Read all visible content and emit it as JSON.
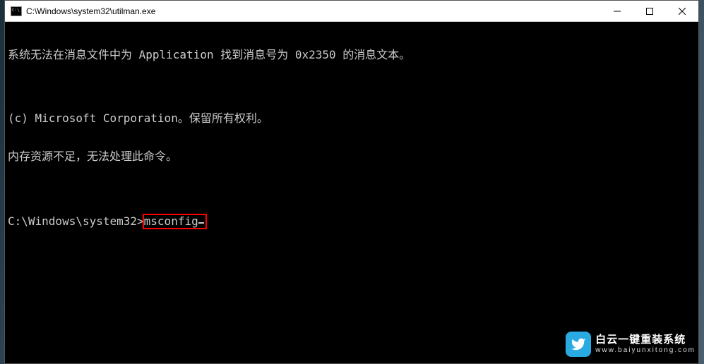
{
  "window": {
    "title": "C:\\Windows\\system32\\utilman.exe"
  },
  "terminal": {
    "line1": "系统无法在消息文件中为 Application 找到消息号为 0x2350 的消息文本。",
    "blank": "",
    "line2": "(c) Microsoft Corporation。保留所有权利。",
    "line3": "内存资源不足，无法处理此命令。",
    "prompt": "C:\\Windows\\system32>",
    "command": "msconfig"
  },
  "watermark": {
    "main": "白云一键重装系统",
    "sub": "www.baiyunxitong.com"
  }
}
